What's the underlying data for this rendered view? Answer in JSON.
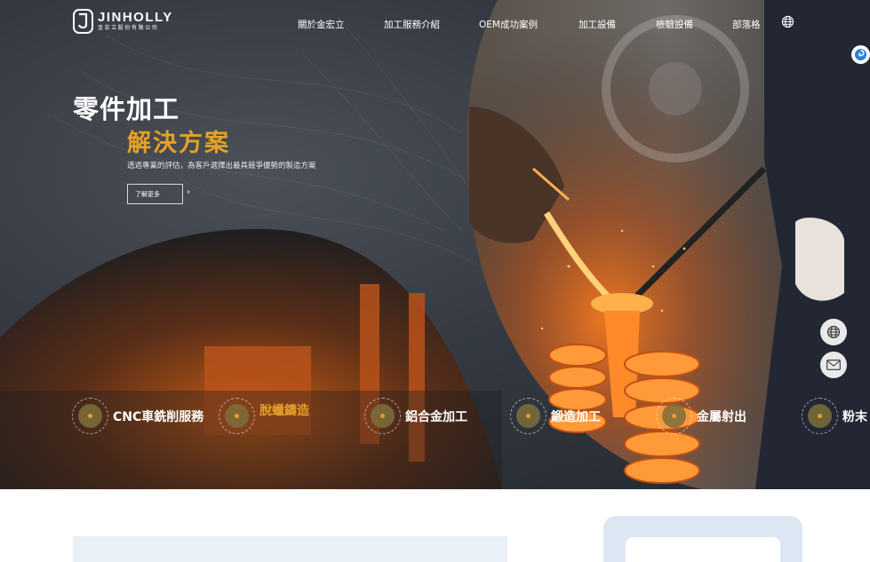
{
  "header": {
    "logo_name": "JINHOLLY",
    "logo_sub": "金宏立股份有限公司",
    "nav": [
      {
        "label": "關於金宏立"
      },
      {
        "label": "加工服務介紹"
      },
      {
        "label": "OEM成功案例"
      },
      {
        "label": "加工設備"
      },
      {
        "label": "檢驗設備"
      },
      {
        "label": "部落格"
      }
    ],
    "language_icon": "globe-icon"
  },
  "hero": {
    "title": "零件加工",
    "subtitle": "解決方案",
    "description": "透過專業的評估，為客戶選擇出最具競爭優勢的製造方案",
    "more_label": "了解更多",
    "more_arrow": "›"
  },
  "services": [
    {
      "label": "CNC車銑削服務",
      "active": false
    },
    {
      "label": "脫蠟鑄造",
      "active": true
    },
    {
      "label": "鋁合金加工",
      "active": false
    },
    {
      "label": "鍛造加工",
      "active": false
    },
    {
      "label": "金屬射出",
      "active": false
    },
    {
      "label": "粉末",
      "active": false
    }
  ],
  "floating": {
    "globe_icon": "globe-icon",
    "mail_icon": "mail-icon",
    "badge_icon": "swirl-icon"
  },
  "colors": {
    "accent": "#e6a126",
    "hero_bg": "#353a42",
    "bottom_bar": "#eaf0f8",
    "bottom_card": "#dde7f3"
  }
}
